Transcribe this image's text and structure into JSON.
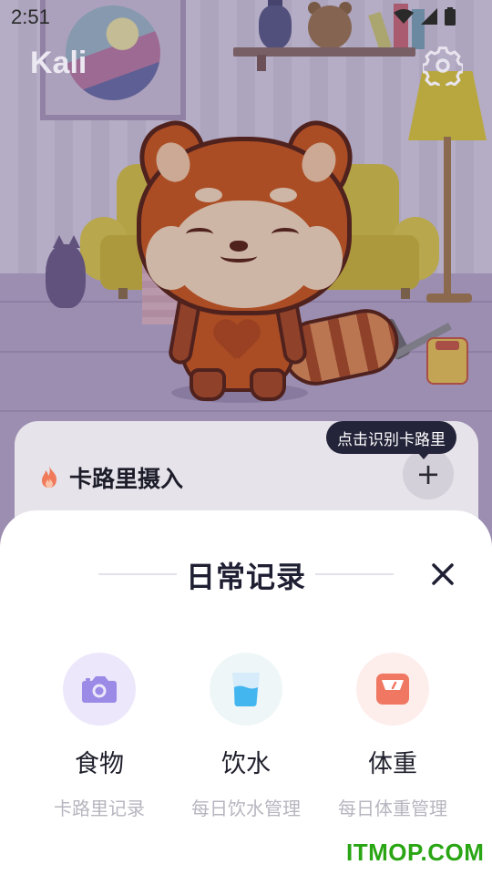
{
  "status_bar": {
    "time": "2:51"
  },
  "header": {
    "app_title": "Kali",
    "settings_icon": "gear-icon"
  },
  "calorie_card": {
    "title": "卡路里摄入",
    "icon": "fire-icon",
    "add_label": "+",
    "tooltip": "点击识别卡路里"
  },
  "sheet": {
    "title": "日常记录",
    "close_icon": "close-icon",
    "options": [
      {
        "label": "食物",
        "desc": "卡路里记录",
        "icon": "camera-icon",
        "bg": "#ece7fb",
        "color": "#9b8ae6"
      },
      {
        "label": "饮水",
        "desc": "每日饮水管理",
        "icon": "water-glass-icon",
        "bg": "#eef6f7",
        "color": "#43b6ef"
      },
      {
        "label": "体重",
        "desc": "每日体重管理",
        "icon": "scale-icon",
        "bg": "#fdeeec",
        "color": "#f07862"
      }
    ]
  },
  "watermark": "ITMOP.COM",
  "colors": {
    "accent_dark": "#23233a",
    "fire": "#f07a5a"
  }
}
